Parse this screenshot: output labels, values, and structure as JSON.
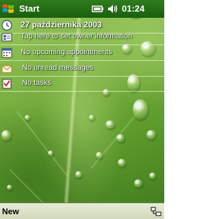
{
  "titlebar": {
    "start_label": "Start",
    "time": "01:24"
  },
  "today": {
    "date": "27 października 2003",
    "owner": "Tap here to set owner information",
    "appointments": "No upcoming appointments",
    "messages": "No unread messages",
    "tasks": "No tasks"
  },
  "menubar": {
    "new_label": "New"
  },
  "icons": {
    "start": "windows-flag-icon",
    "battery": "battery-icon",
    "volume": "speaker-volume-icon",
    "clock": "clock-icon",
    "owner": "owner-card-icon",
    "calendar": "calendar-icon",
    "messages": "envelope-icon",
    "tasks": "task-checkbox-icon",
    "input": "input-panel-icon"
  },
  "colors": {
    "titlebar": "#195e0e",
    "menubar": "#cfd6b8",
    "text_on_green": "#ffffff"
  }
}
